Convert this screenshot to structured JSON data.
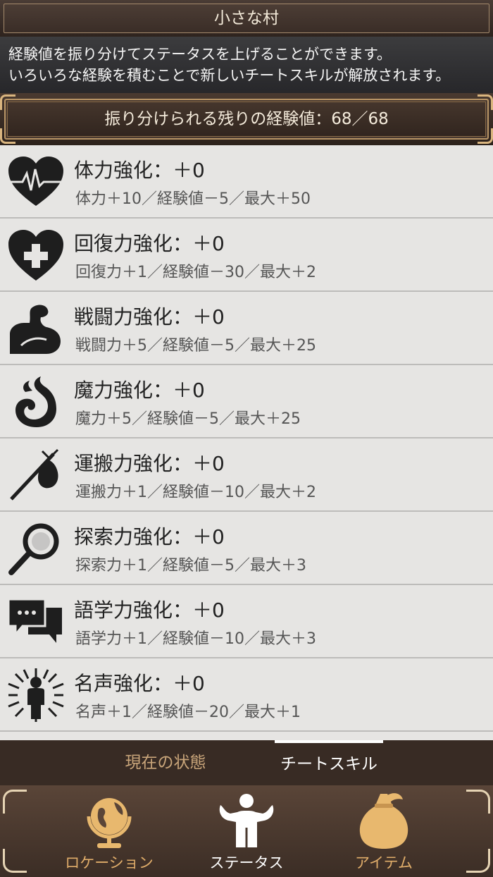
{
  "header": {
    "title": "小さな村"
  },
  "description": {
    "line1": "経験値を振り分けてステータスを上げることができます。",
    "line2": "いろいろな経験を積むことで新しいチートスキルが解放されます。"
  },
  "exp_banner": {
    "text": "振り分けられる残りの経験値：68／68"
  },
  "skills": [
    {
      "name": "体力強化：＋0",
      "detail": "体力＋10／経験値－5／最大＋50",
      "icon": "heartbeat-icon"
    },
    {
      "name": "回復力強化：＋0",
      "detail": "回復力＋1／経験値－30／最大＋2",
      "icon": "heart-cross-icon"
    },
    {
      "name": "戦闘力強化：＋0",
      "detail": "戦闘力＋5／経験値－5／最大＋25",
      "icon": "flexed-arm-icon"
    },
    {
      "name": "魔力強化：＋0",
      "detail": "魔力＋5／経験値－5／最大＋25",
      "icon": "magic-swirl-icon"
    },
    {
      "name": "運搬力強化：＋0",
      "detail": "運搬力＋1／経験値－10／最大＋2",
      "icon": "bindle-icon"
    },
    {
      "name": "探索力強化：＋0",
      "detail": "探索力＋1／経験値－5／最大＋3",
      "icon": "magnifier-icon"
    },
    {
      "name": "語学力強化：＋0",
      "detail": "語学力＋1／経験値－10／最大＋3",
      "icon": "speech-bubbles-icon"
    },
    {
      "name": "名声強化：＋0",
      "detail": "名声＋1／経験値－20／最大＋1",
      "icon": "radiant-person-icon"
    }
  ],
  "tabs": {
    "status": "現在の状態",
    "cheat_skill": "チートスキル",
    "active": "cheat_skill"
  },
  "bottom_nav": {
    "location": "ロケーション",
    "status": "ステータス",
    "item": "アイテム",
    "active": "status"
  },
  "colors": {
    "accent_gold": "#d9b57f",
    "nav_inactive": "#c9a57a",
    "nav_active": "#ffffff"
  }
}
